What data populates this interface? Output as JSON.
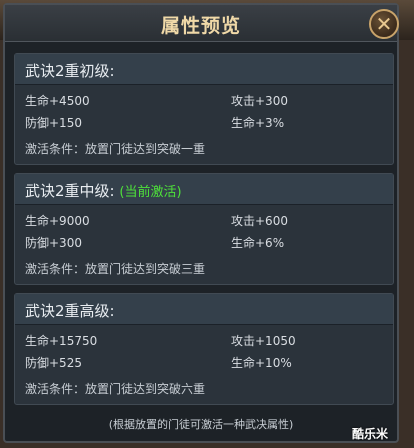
{
  "header": {
    "title": "属性预览"
  },
  "close_glyph": "✕",
  "sections": [
    {
      "title": "武诀2重初级:",
      "note": "",
      "stats": [
        {
          "label": "生命+4500",
          "side": "left"
        },
        {
          "label": "攻击+300",
          "side": "right"
        },
        {
          "label": "防御+150",
          "side": "left"
        },
        {
          "label": "生命+3%",
          "side": "right"
        }
      ],
      "condition": "激活条件：放置门徒达到突破一重"
    },
    {
      "title": "武诀2重中级:",
      "note": "(当前激活)",
      "stats": [
        {
          "label": "生命+9000",
          "side": "left"
        },
        {
          "label": "攻击+600",
          "side": "right"
        },
        {
          "label": "防御+300",
          "side": "left"
        },
        {
          "label": "生命+6%",
          "side": "right"
        }
      ],
      "condition": "激活条件：放置门徒达到突破三重"
    },
    {
      "title": "武诀2重高级:",
      "note": "",
      "stats": [
        {
          "label": "生命+15750",
          "side": "left"
        },
        {
          "label": "攻击+1050",
          "side": "right"
        },
        {
          "label": "防御+525",
          "side": "left"
        },
        {
          "label": "生命+10%",
          "side": "right"
        }
      ],
      "condition": "激活条件：放置门徒达到突破六重"
    }
  ],
  "footer": "(根据放置的门徒可激活一种武决属性)",
  "watermark": "酷乐米",
  "colors": {
    "active_note": "#4ee23a",
    "title": "#f0d9a8"
  }
}
